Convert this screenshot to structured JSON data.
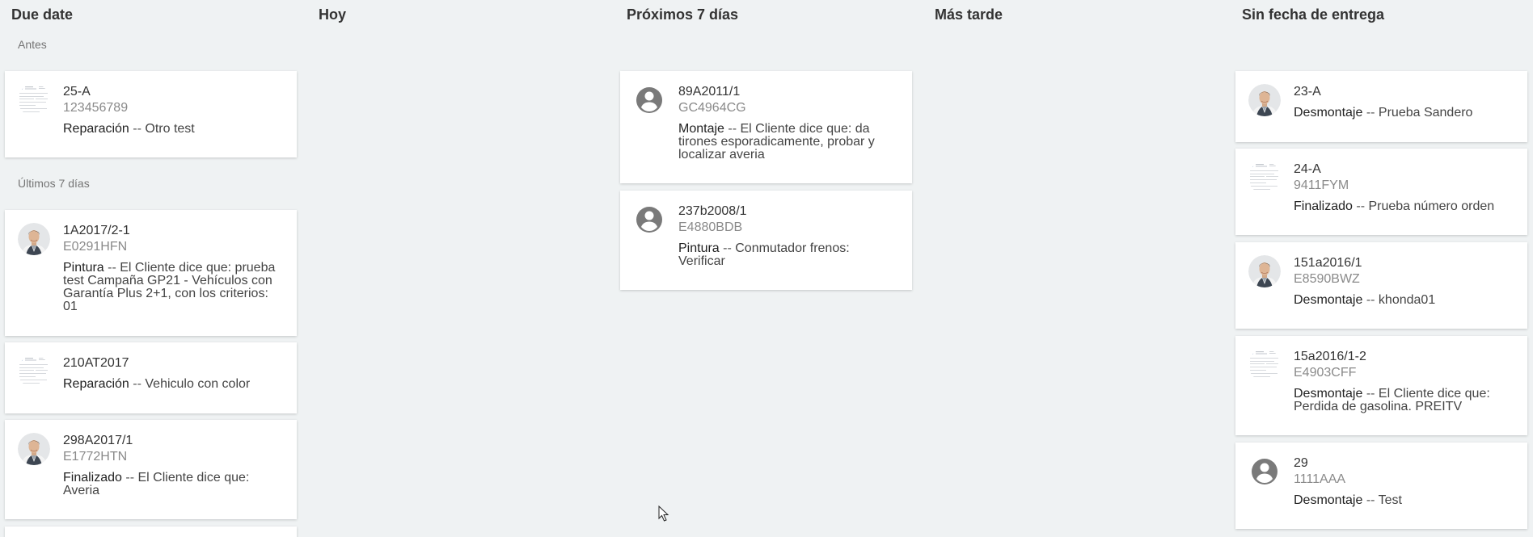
{
  "columns": {
    "due_date": "Due date",
    "hoy": "Hoy",
    "proximos": "Próximos 7 días",
    "mas_tarde": "Más tarde",
    "sin_fecha": "Sin fecha de entrega"
  },
  "sections": {
    "antes": "Antes",
    "ultimos": "Últimos 7 días"
  },
  "separator": " -- ",
  "cards": {
    "c1": {
      "id": "25-A",
      "plate": "123456789",
      "type": "Reparación",
      "desc": "Otro test",
      "avatar": "document-thumbnail"
    },
    "c2": {
      "id": "1A2017/2-1",
      "plate": "E0291HFN",
      "type": "Pintura",
      "desc": "El Cliente dice que: prueba test Campaña GP21 - Vehículos con Garantía Plus 2+1, con los criterios: 01",
      "avatar": "person-photo"
    },
    "c3": {
      "id": "210AT2017",
      "type": "Reparación",
      "desc": "Vehiculo con color",
      "avatar": "document-thumbnail"
    },
    "c4": {
      "id": "298A2017/1",
      "plate": "E1772HTN",
      "type": "Finalizado",
      "desc": "El Cliente dice que: Averia",
      "avatar": "person-photo"
    },
    "c5": {
      "id": "89A2011/1",
      "plate": "GC4964CG",
      "type": "Montaje",
      "desc": "El Cliente dice que: da tirones esporadicamente, probar y localizar averia",
      "avatar": "account-circle-icon"
    },
    "c6": {
      "id": "237b2008/1",
      "plate": "E4880BDB",
      "type": "Pintura",
      "desc": "Conmutador frenos: Verificar",
      "avatar": "account-circle-icon"
    },
    "c7": {
      "id": "23-A",
      "type": "Desmontaje",
      "desc": "Prueba Sandero",
      "avatar": "person-photo"
    },
    "c8": {
      "id": "24-A",
      "plate": "9411FYM",
      "type": "Finalizado",
      "desc": "Prueba número orden",
      "avatar": "document-thumbnail"
    },
    "c9": {
      "id": "151a2016/1",
      "plate": "E8590BWZ",
      "type": "Desmontaje",
      "desc": "khonda01",
      "avatar": "person-photo"
    },
    "c10": {
      "id": "15a2016/1-2",
      "plate": "E4903CFF",
      "type": "Desmontaje",
      "desc": "El Cliente dice que: Perdida de gasolina. PREITV",
      "avatar": "document-thumbnail"
    },
    "c11": {
      "id": "29",
      "plate": "1111AAA",
      "type": "Desmontaje",
      "desc": "Test",
      "avatar": "account-circle-icon"
    }
  }
}
